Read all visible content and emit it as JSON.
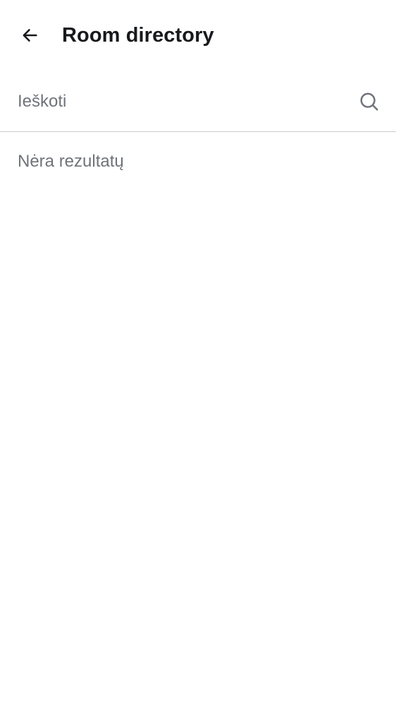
{
  "header": {
    "title": "Room directory",
    "back_icon": "arrow-left-icon"
  },
  "search": {
    "placeholder": "Ieškoti",
    "value": "",
    "icon": "search-icon"
  },
  "results": {
    "empty_message": "Nėra rezultatų"
  },
  "colors": {
    "title": "#17191c",
    "secondary_text": "#6f737a",
    "divider": "#c9cbcf",
    "background": "#ffffff"
  }
}
